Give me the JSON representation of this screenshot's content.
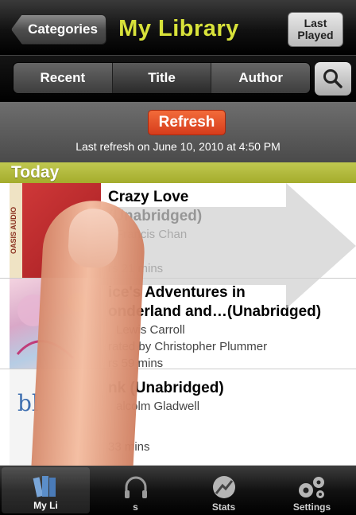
{
  "nav": {
    "back_label": "Categories",
    "title": "My Library",
    "last_played_label": "Last\nPlayed"
  },
  "segments": [
    "Recent",
    "Title",
    "Author"
  ],
  "selected_segment": "Title",
  "search_icon": "search-icon",
  "refresh": {
    "button_label": "Refresh",
    "status": "Last refresh on June 10, 2010 at 4:50 PM"
  },
  "section": {
    "header": "Today"
  },
  "books": [
    {
      "title_line1": "Crazy Love",
      "title_line2": "(Unabridged)",
      "author": "Francis Chan",
      "narrator": "",
      "duration": "rs 21 mins",
      "cover_text": "OASIS AUDIO"
    },
    {
      "title_line1": "ice's Adventures in",
      "title_line2": "onderland and…(Unabridged)",
      "author": "Lewis Carroll",
      "narrator": "rated by Christopher Plummer",
      "duration": "rs 59 mins",
      "cover_text": ""
    },
    {
      "title_line1": "nk (Unabridged)",
      "title_line2": "",
      "author": "alcolm Gladwell",
      "narrator": "",
      "duration": "33 mins",
      "cover_text": "bl"
    }
  ],
  "tabs": [
    {
      "label": "My Li",
      "icon": "books-icon",
      "active": true
    },
    {
      "label": "s",
      "icon": "headphones-icon",
      "active": false
    },
    {
      "label": "Stats",
      "icon": "stats-icon",
      "active": false
    },
    {
      "label": "Settings",
      "icon": "gears-icon",
      "active": false
    }
  ],
  "colors": {
    "title_accent": "#d8e23a",
    "section_header": "#b0b83a",
    "refresh_button": "#e24e28"
  }
}
